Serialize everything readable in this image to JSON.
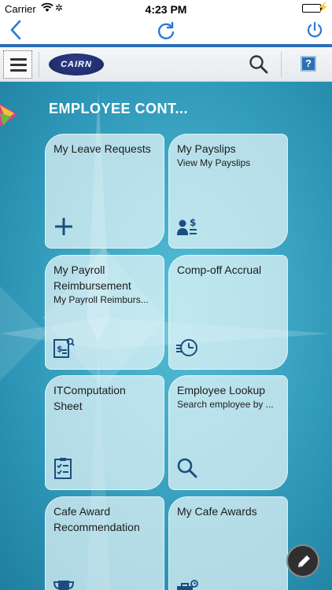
{
  "status_bar": {
    "carrier": "Carrier",
    "time": "4:23 PM",
    "wifi_icon": "wifi-icon",
    "battery_icon": "battery-icon"
  },
  "nav": {
    "back_icon": "chevron-left-icon",
    "reload_icon": "reload-icon",
    "power_icon": "power-icon"
  },
  "header": {
    "menu_icon": "hamburger-menu-icon",
    "logo_text": "CAIRN",
    "search_icon": "search-icon",
    "help_label": "?"
  },
  "page": {
    "title": "EMPLOYEE CONT..."
  },
  "tiles": [
    {
      "title": "My Leave Requests",
      "subtitle": "",
      "icon": "plus-icon"
    },
    {
      "title": "My Payslips",
      "subtitle": "View My Payslips",
      "icon": "person-dollar-icon"
    },
    {
      "title": "My Payroll Reimbursement",
      "subtitle": "My Payroll Reimburs...",
      "icon": "receipt-search-icon"
    },
    {
      "title": "Comp-off Accrual",
      "subtitle": "",
      "icon": "clock-list-icon"
    },
    {
      "title": "ITComputation Sheet",
      "subtitle": "",
      "icon": "checklist-icon"
    },
    {
      "title": "Employee Lookup",
      "subtitle": "Search employee by ...",
      "icon": "search-icon"
    },
    {
      "title": "Cafe Award Recommendation",
      "subtitle": "",
      "icon": "trophy-icon"
    },
    {
      "title": "My Cafe Awards",
      "subtitle": "",
      "icon": "award-briefcase-icon"
    }
  ],
  "fab": {
    "icon": "pencil-icon"
  },
  "colors": {
    "accent_blue": "#2a6fb8",
    "icon_blue": "#1a4f7d",
    "tile_bg": "#e8f6fa",
    "background_teal": "#3fa9c6"
  }
}
